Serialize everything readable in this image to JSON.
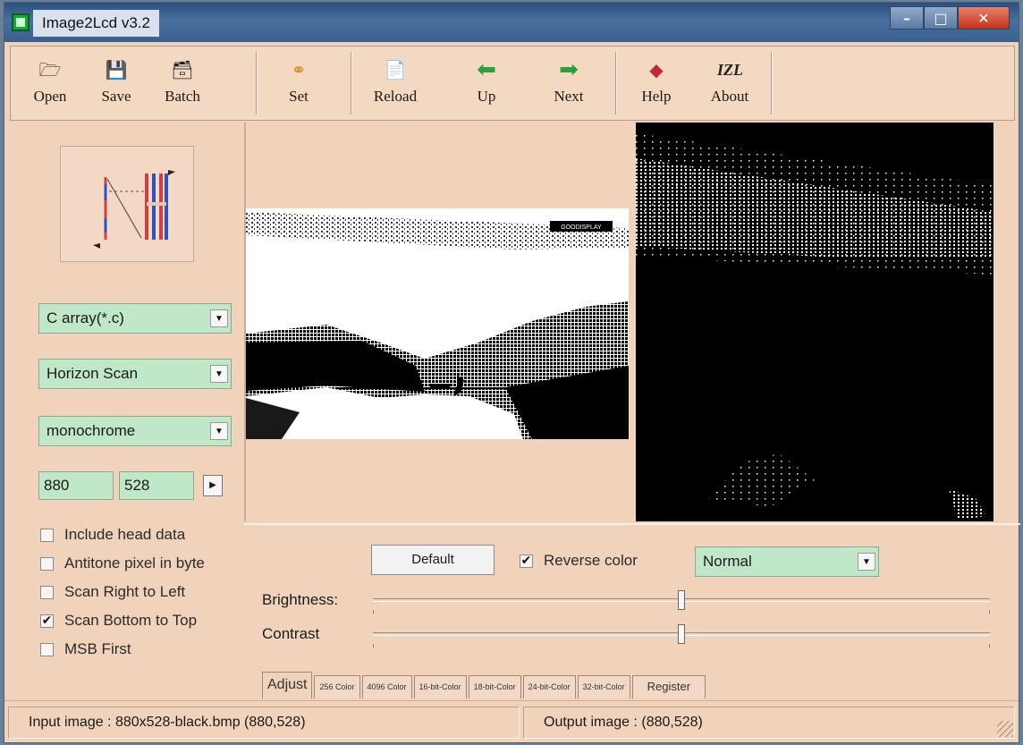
{
  "window": {
    "title": "Image2Lcd v3.2"
  },
  "toolbar": {
    "open": "Open",
    "save": "Save",
    "batch": "Batch",
    "set": "Set",
    "reload": "Reload",
    "up": "Up",
    "next": "Next",
    "help": "Help",
    "about": "About",
    "about_icon_text": "IZL"
  },
  "left": {
    "output_type": "C array(*.c)",
    "scan_mode": "Horizon Scan",
    "color_mode": "monochrome",
    "width": "880",
    "height": "528",
    "options": [
      {
        "label": "Include head data",
        "checked": false
      },
      {
        "label": "Antitone pixel in byte",
        "checked": false
      },
      {
        "label": "Scan Right to Left",
        "checked": false
      },
      {
        "label": "Scan Bottom to Top",
        "checked": true
      },
      {
        "label": "MSB First",
        "checked": false
      }
    ]
  },
  "preview": {
    "watermark": "GOODISPLAY"
  },
  "adjust": {
    "default_button": "Default",
    "reverse_color": "Reverse color",
    "reverse_checked": true,
    "mode": "Normal",
    "brightness_label": "Brightness:",
    "contrast_label": "Contrast",
    "brightness_level": 0.5,
    "contrast_level": 0.5
  },
  "tabs": [
    "Adjust",
    "256 Color",
    "4096 Color",
    "16-bit-Color",
    "18-bit-Color",
    "24-bit-Color",
    "32-bit-Color",
    "Register"
  ],
  "status": {
    "input": "Input image :  880x528-black.bmp (880,528)",
    "output": "Output image :   (880,528)"
  },
  "colors": {
    "accent_green_field": "#bfe7c8",
    "panel_bg": "#f1d3bc"
  }
}
